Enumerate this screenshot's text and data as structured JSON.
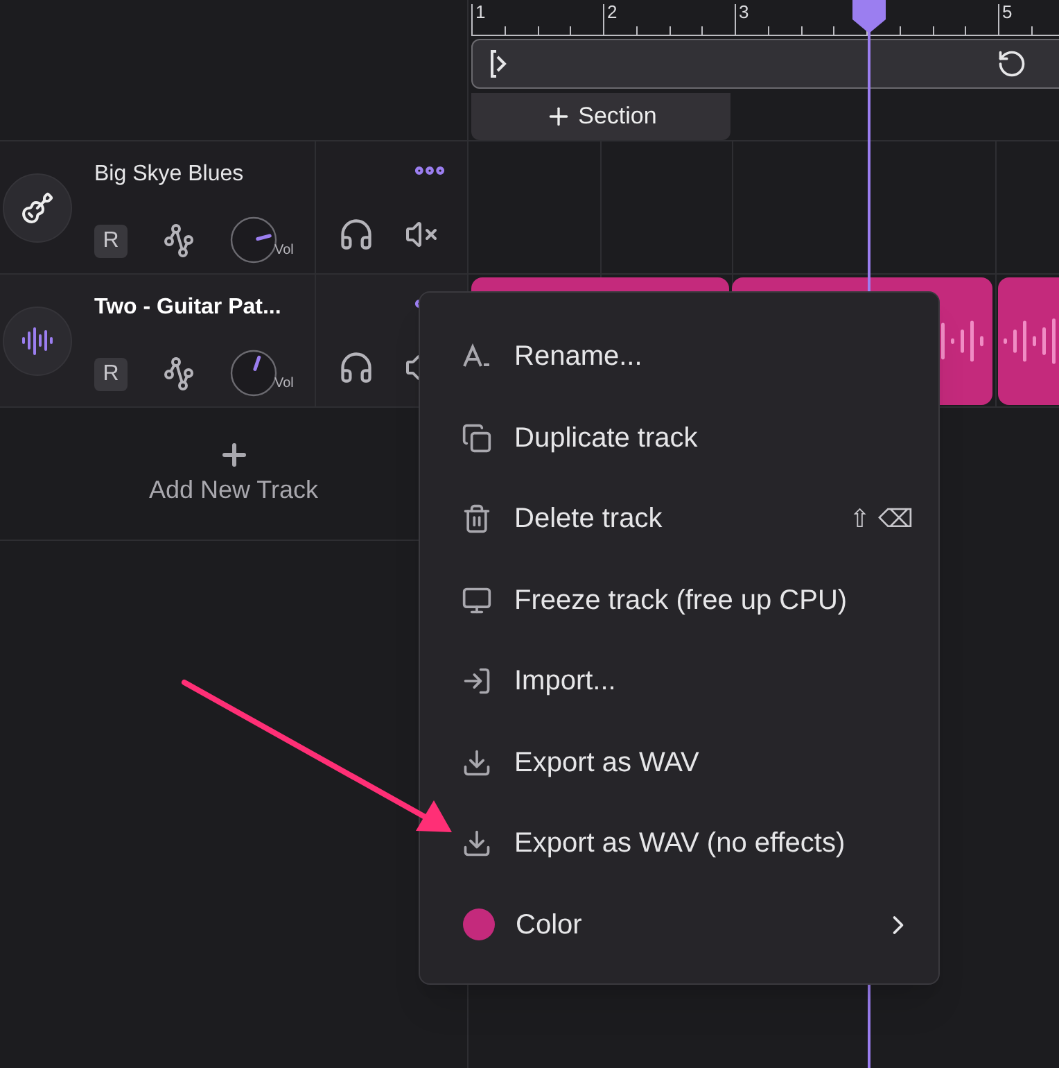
{
  "ruler": {
    "labels": [
      "1",
      "2",
      "3",
      "5"
    ]
  },
  "section_button": {
    "label": "Section"
  },
  "tracks": [
    {
      "kind": "instrument",
      "name": "Big Skye Blues",
      "selected": false,
      "record_label": "R",
      "knob_label": "Vol"
    },
    {
      "kind": "audio",
      "name": "Two - Guitar Pat...",
      "selected": true,
      "record_label": "R",
      "knob_label": "Vol"
    }
  ],
  "add_track": {
    "label": "Add New Track"
  },
  "context_menu": {
    "items": [
      {
        "kind": "action",
        "label": "Rename..."
      },
      {
        "kind": "action",
        "label": "Duplicate track"
      },
      {
        "kind": "action",
        "label": "Delete track",
        "shortcut": [
          "⇧",
          "⌫"
        ]
      },
      {
        "kind": "action",
        "label": "Freeze track (free up CPU)"
      },
      {
        "kind": "action",
        "label": "Import..."
      },
      {
        "kind": "action",
        "label": "Export as WAV"
      },
      {
        "kind": "action",
        "label": "Export as WAV (no effects)"
      },
      {
        "kind": "color",
        "label": "Color",
        "color": "#c42a7c"
      }
    ]
  }
}
